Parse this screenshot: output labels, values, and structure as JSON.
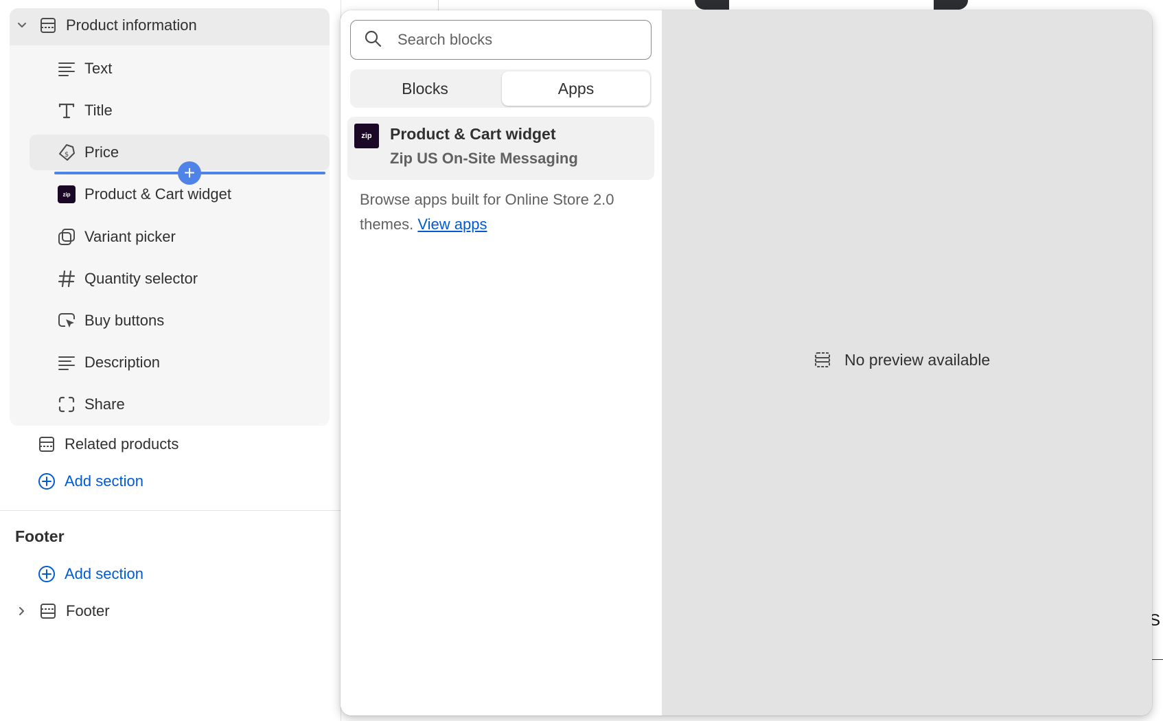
{
  "sidebar": {
    "group_title": "Product information",
    "blocks": [
      {
        "label": "Text",
        "icon": "text-lines-icon"
      },
      {
        "label": "Title",
        "icon": "title-T-icon"
      },
      {
        "label": "Price",
        "icon": "price-tag-icon"
      },
      {
        "label": "Product & Cart widget",
        "icon": "zip-app-icon"
      },
      {
        "label": "Variant picker",
        "icon": "variant-picker-icon"
      },
      {
        "label": "Quantity selector",
        "icon": "hash-icon"
      },
      {
        "label": "Buy buttons",
        "icon": "cursor-click-icon"
      },
      {
        "label": "Description",
        "icon": "text-lines-icon"
      },
      {
        "label": "Share",
        "icon": "share-frame-icon"
      }
    ],
    "related_products": "Related products",
    "add_section": "Add section",
    "footer_group_title": "Footer",
    "footer_add_section": "Add section",
    "footer_item": "Footer",
    "zip_badge": "zip"
  },
  "picker": {
    "search_placeholder": "Search blocks",
    "tabs": [
      {
        "label": "Blocks",
        "selected": false
      },
      {
        "label": "Apps",
        "selected": true
      }
    ],
    "app": {
      "logo": "zip",
      "title": "Product & Cart widget",
      "subtitle": "Zip US On-Site Messaging"
    },
    "browse_text": "Browse apps built for Online Store 2.0 themes.",
    "view_apps": "View apps"
  },
  "preview": {
    "no_preview": "No preview available",
    "edge_letter": "S"
  },
  "colors": {
    "accent_blue": "#005bd3",
    "insert_blue": "#4f83e8",
    "zip_dark": "#1a0826"
  }
}
